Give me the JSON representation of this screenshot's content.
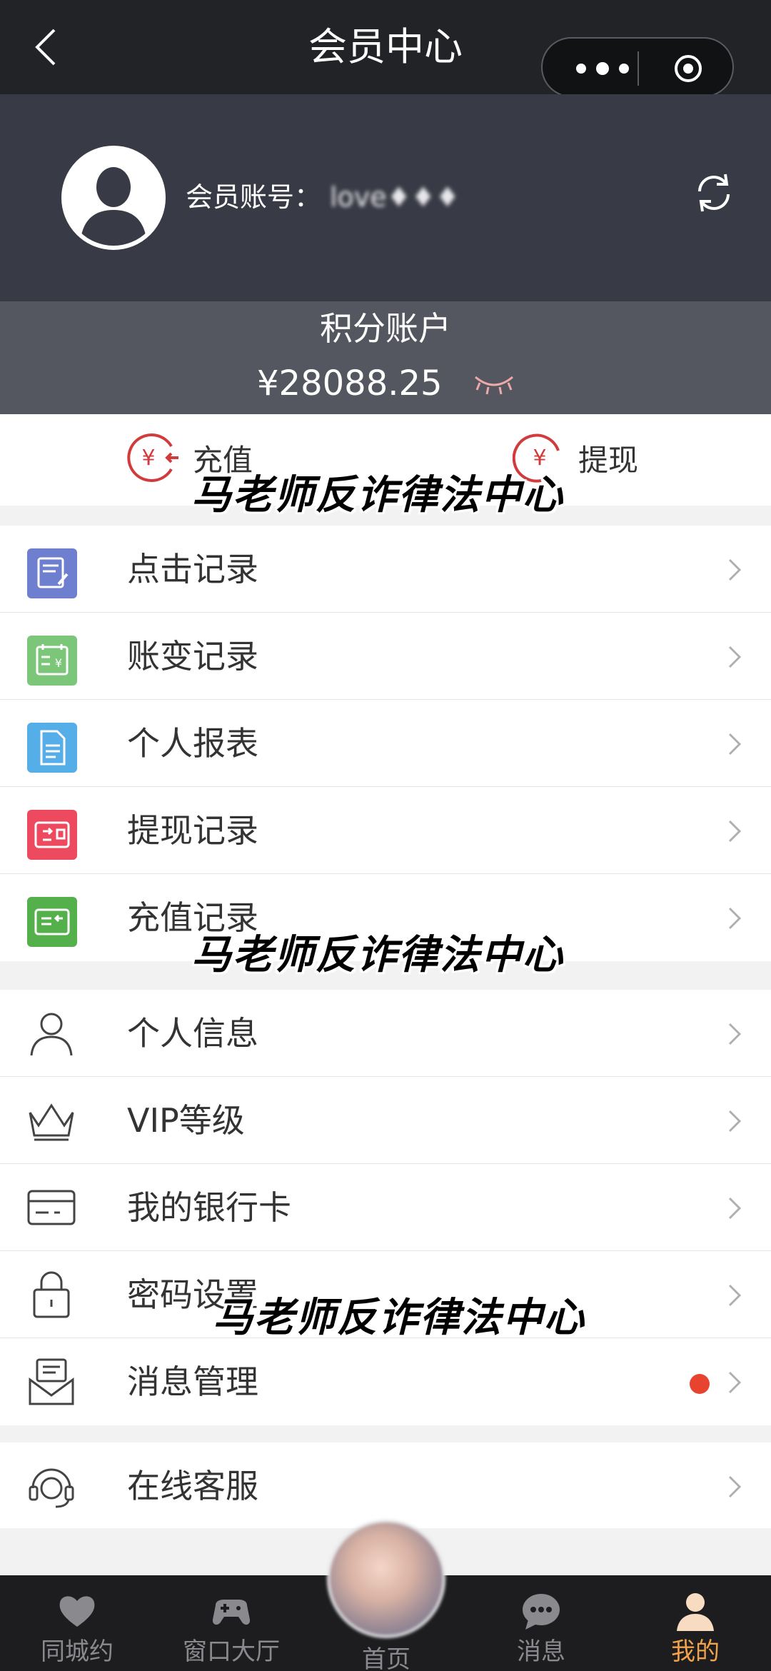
{
  "nav": {
    "title": "会员中心"
  },
  "user": {
    "account_label": "会员账号：",
    "account_value": "love♦♦♦"
  },
  "points": {
    "title": "积分账户",
    "amount": "¥28088.25"
  },
  "actions": {
    "recharge": "充值",
    "withdraw": "提现"
  },
  "menu_group1": [
    {
      "label": "点击记录",
      "icon": "click-record-icon",
      "color": "#6e7fcf"
    },
    {
      "label": "账变记录",
      "icon": "account-change-icon",
      "color": "#7cc67a"
    },
    {
      "label": "个人报表",
      "icon": "report-icon",
      "color": "#55aee8"
    },
    {
      "label": "提现记录",
      "icon": "withdraw-record-icon",
      "color": "#ee4a5f"
    },
    {
      "label": "充值记录",
      "icon": "recharge-record-icon",
      "color": "#54b04a"
    }
  ],
  "menu_group2": [
    {
      "label": "个人信息",
      "icon": "person-icon"
    },
    {
      "label": "VIP等级",
      "icon": "crown-icon"
    },
    {
      "label": "我的银行卡",
      "icon": "bank-card-icon"
    },
    {
      "label": "密码设置",
      "icon": "lock-icon"
    },
    {
      "label": "消息管理",
      "icon": "message-icon"
    }
  ],
  "menu_group3": [
    {
      "label": "在线客服",
      "icon": "headset-icon"
    }
  ],
  "watermark": "马老师反诈律法中心",
  "tabs": [
    {
      "label": "同城约",
      "icon": "heart-icon"
    },
    {
      "label": "窗口大厅",
      "icon": "gamepad-icon"
    },
    {
      "label": "首页",
      "icon": "home-avatar"
    },
    {
      "label": "消息",
      "icon": "chat-icon"
    },
    {
      "label": "我的",
      "icon": "profile-icon"
    }
  ],
  "colors": {
    "accent": "#f2a24a",
    "red": "#d23b3b",
    "dot": "#e8432f"
  }
}
